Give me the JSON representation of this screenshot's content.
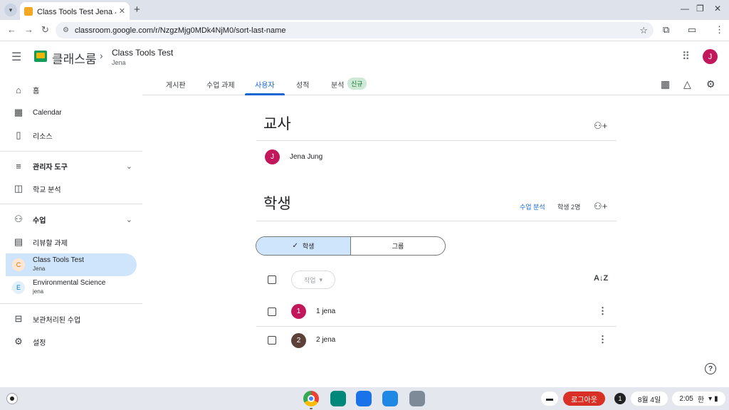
{
  "browser": {
    "tab_title": "Class Tools Test Jena 사용자",
    "tab_close": "✕",
    "new_tab": "+",
    "url": "classroom.google.com/r/NzgzMjg0MDk4NjM0/sort-last-name"
  },
  "header": {
    "brand": "클래스룸",
    "course_title": "Class Tools Test",
    "course_subtitle": "Jena",
    "avatar_letter": "J"
  },
  "sidebar": {
    "home": "홈",
    "calendar": "Calendar",
    "resources": "리소스",
    "admin_tools": "관리자 도구",
    "school_analytics": "학교 분석",
    "classes": "수업",
    "review": "리뷰할 과제",
    "courses": [
      {
        "letter": "C",
        "name": "Class Tools Test",
        "owner": "Jena",
        "color": "#e37400"
      },
      {
        "letter": "E",
        "name": "Environmental Science",
        "owner": "jena",
        "color": "#137cbd"
      }
    ],
    "archived": "보관처리된 수업",
    "settings": "설정"
  },
  "tabs": {
    "stream": "게시판",
    "classwork": "수업 과제",
    "people": "사용자",
    "grades": "성적",
    "analytics": "분석",
    "new_badge": "신규"
  },
  "teachers": {
    "title": "교사",
    "list": [
      {
        "letter": "J",
        "name": "Jena Jung"
      }
    ]
  },
  "students": {
    "title": "학생",
    "analytics_link": "수업 분석",
    "count": "학생 2명",
    "toggle": {
      "students": "학생",
      "groups": "그룹"
    },
    "action": "작업",
    "list": [
      {
        "letter": "1",
        "name": "1 jena",
        "color": "#c2185b"
      },
      {
        "letter": "2",
        "name": "2 jena",
        "color": "#5d4037"
      }
    ]
  },
  "shelf": {
    "logout": "로그아웃",
    "notifications": "1",
    "date": "8월 4일",
    "time": "2:05",
    "ime": "한"
  }
}
